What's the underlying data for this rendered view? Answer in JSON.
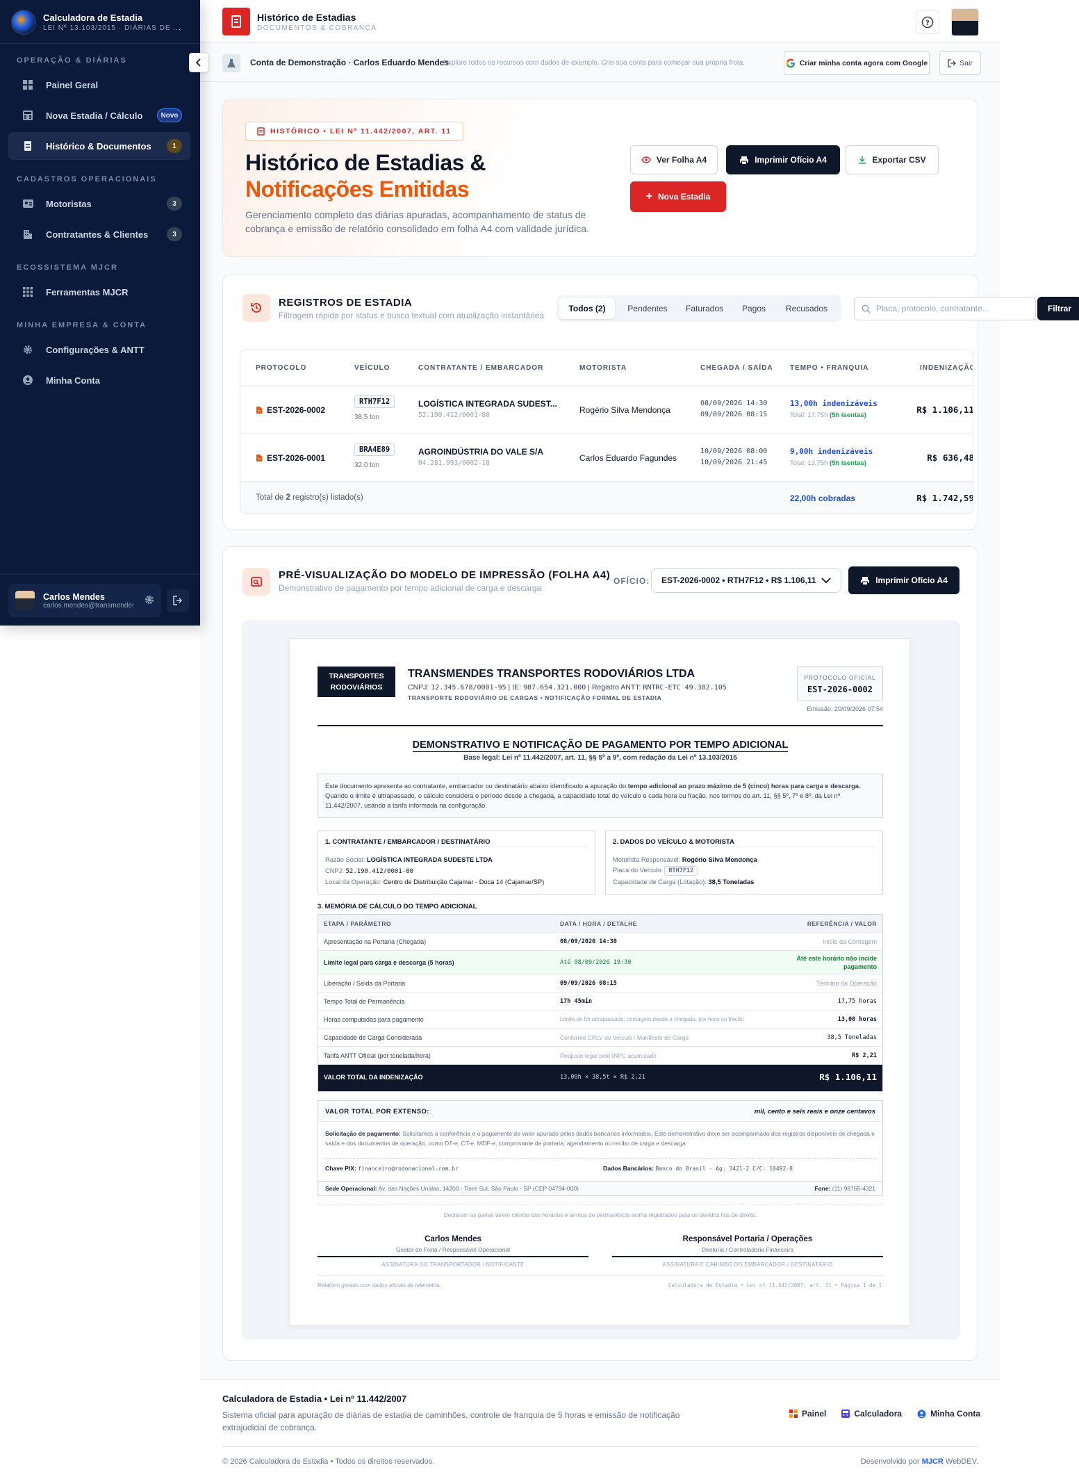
{
  "sidebar": {
    "brand_title": "Calculadora de Estadia",
    "brand_sub": "LEI Nº 13.103/2015 · DIÁRIAS DE ...",
    "sections": {
      "ops": "OPERAÇÃO & DIÁRIAS",
      "cad": "CADASTROS OPERACIONAIS",
      "eco": "ECOSSISTEMA MJCR",
      "emp": "MINHA EMPRESA & CONTA"
    },
    "items": [
      {
        "label": "Painel Geral"
      },
      {
        "label": "Nova Estadia / Cálculo",
        "badge": "Novo"
      },
      {
        "label": "Histórico & Documentos",
        "badge": "1"
      },
      {
        "label": "Motoristas",
        "badge": "3"
      },
      {
        "label": "Contratantes & Clientes",
        "badge": "3"
      },
      {
        "label": "Ferramentas MJCR"
      },
      {
        "label": "Configurações & ANTT"
      },
      {
        "label": "Minha Conta"
      }
    ],
    "user": {
      "name": "Carlos Mendes",
      "email": "carlos.mendes@transmendes"
    }
  },
  "header": {
    "title": "Histórico de Estadias",
    "subtitle": "DOCUMENTOS & COBRANÇA"
  },
  "demo": {
    "title": "Conta de Demonstração · Carlos Eduardo Mendes",
    "desc": "Explore todos os recursos com dados de exemplo. Crie sua conta para começar sua própria frota.",
    "google_btn": "Criar minha conta agora com Google",
    "logout_btn": "Sair"
  },
  "hero": {
    "pill": "HISTÓRICO • LEI Nº 11.442/2007, ART. 11",
    "title_1": "Histórico de Estadias &",
    "title_2": "Notificações Emitidas",
    "desc": "Gerenciamento completo das diárias apuradas, acompanhamento de status de cobrança e emissão de relatório consolidado em folha A4 com validade jurídica.",
    "btn_view": "Ver Folha A4",
    "btn_print": "Imprimir Ofício A4",
    "btn_export": "Exportar CSV",
    "btn_new": "Nova Estadia"
  },
  "registros": {
    "title": "REGISTROS DE ESTADIA",
    "subtitle": "Filtragem rápida por status e busca textual com atualização instantânea",
    "tabs": [
      "Todos (2)",
      "Pendentes",
      "Faturados",
      "Pagos",
      "Recusados"
    ],
    "search_placeholder": "Placa, protocolo, contratante...",
    "filter_btn": "Filtrar",
    "columns": [
      "PROTOCOLO",
      "VEÍCULO",
      "CONTRATANTE / EMBARCADOR",
      "MOTORISTA",
      "CHEGADA / SAÍDA",
      "TEMPO • FRANQUIA",
      "INDENIZAÇÃO"
    ],
    "rows": [
      {
        "protocol": "EST-2026-0002",
        "plate": "RTH7F12",
        "weight": "38,5 ton",
        "company": "LOGÍSTICA INTEGRADA SUDEST...",
        "cnpj": "52.190.412/0001-80",
        "driver": "Rogério Silva Mendonça",
        "arrival": "08/09/2026 14:30",
        "departure": "09/09/2026 08:15",
        "hours": "13,00h indenizáveis",
        "total": "Total: 17,75h",
        "exempt": "(5h isentas)",
        "value": "R$ 1.106,11"
      },
      {
        "protocol": "EST-2026-0001",
        "plate": "BRA4E89",
        "weight": "32,0 ton",
        "company": "AGROINDÚSTRIA DO VALE S/A",
        "cnpj": "04.281.993/0002-18",
        "driver": "Carlos Eduardo Fagundes",
        "arrival": "10/09/2026 08:00",
        "departure": "10/09/2026 21:45",
        "hours": "9,00h indenizáveis",
        "total": "Total: 13,75h",
        "exempt": "(5h isentas)",
        "value": "R$ 636,48"
      }
    ],
    "footer_pre": "Total de ",
    "footer_count": "2",
    "footer_post": " registro(s) listado(s)",
    "footer_hours": "22,00h cobradas",
    "footer_value": "R$ 1.742,59"
  },
  "preview": {
    "title": "PRÉ-VISUALIZAÇÃO DO MODELO DE IMPRESSÃO (FOLHA A4)",
    "subtitle": "Demonstrativo de pagamento por tempo adicional de carga e descarga",
    "oficio_label": "OFÍCIO:",
    "oficio_value": "EST-2026-0002 • RTH7F12 • R$ 1.106,11",
    "print_btn": "Imprimir Ofício A4"
  },
  "doc": {
    "logo_text": "TRANSPORTES RODOVIÁRIOS",
    "company": "TRANSMENDES TRANSPORTES RODOVIÁRIOS LTDA",
    "ids_pre": "CNPJ: ",
    "cnpj": "12.345.678/0001-95",
    "ie_pre": " | IE: ",
    "ie": "987.654.321.000",
    "antt_pre": " | Registro ANTT: ",
    "antt": "RNTRC-ETC 49.382.105",
    "tagline": "TRANSPORTE RODOVIÁRIO DE CARGAS • NOTIFICAÇÃO FORMAL DE ESTADIA",
    "protocol_label": "PROTOCOLO OFICIAL",
    "protocol": "EST-2026-0002",
    "emission": "Emissão: 20/09/2026 07:54",
    "title": "DEMONSTRATIVO E NOTIFICAÇÃO DE PAGAMENTO POR TEMPO ADICIONAL",
    "legal": "Base legal: Lei nº 11.442/2007, art. 11, §§ 5º a 9º, com redação da Lei nº 13.103/2015",
    "intro_1": "Este documento apresenta ao contratante, embarcador ou destinatário abaixo identificado a apuração do ",
    "intro_b": "tempo adicional ao prazo máximo de 5 (cinco) horas para carga e descarga.",
    "intro_2": "Quando o limite é ultrapassado, o cálculo considera o período desde a chegada, a capacidade total do veículo e cada hora ou fração, nos termos do art. 11, §§ 5º, 7º e 8º, da Lei nº 11.442/2007, usando a tarifa informada na configuração.",
    "s1_title": "1. CONTRATANTE / EMBARCADOR / DESTINATÁRIO",
    "s1_l1": "Razão Social: ",
    "s1_v1": "LOGÍSTICA INTEGRADA SUDESTE LTDA",
    "s1_l2": "CNPJ: ",
    "s1_v2": "52.190.412/0001-80",
    "s1_l3": "Local da Operação: ",
    "s1_v3": "Centro de Distribuição Cajamar - Doca 14 (Cajamar/SP)",
    "s2_title": "2. DADOS DO VEÍCULO & MOTORISTA",
    "s2_l1": "Motorista Responsável: ",
    "s2_v1": "Rogério Silva Mendonça",
    "s2_l2": "Placa do Veículo: ",
    "s2_v2": "RTH7F12",
    "s2_l3": "Capacidade de Carga (Lotação): ",
    "s2_v3": "38,5 Toneladas",
    "s3_title": "3. MEMÓRIA DE CÁLCULO DO TEMPO ADICIONAL",
    "calc_cols": [
      "ETAPA / PARÂMETRO",
      "DATA / HORA / DETALHE",
      "REFERÊNCIA / VALOR"
    ],
    "calc_rows": [
      [
        "Apresentação na Portaria (Chegada)",
        "08/09/2026 14:30",
        "Início da Contagem"
      ],
      [
        "Limite legal para carga e descarga (5 horas)",
        "Até 08/09/2026 19:30",
        "Até este horário não incide pagamento"
      ],
      [
        "Liberação / Saída da Portaria",
        "09/09/2026 08:15",
        "Término da Operação"
      ],
      [
        "Tempo Total de Permanência",
        "17h 45min",
        "17,75 horas"
      ],
      [
        "Horas computadas para pagamento",
        "Limite de 5h ultrapassado; contagem desde a chegada, por hora ou fração",
        "13,00 horas"
      ],
      [
        "Capacidade de Carga Considerada",
        "Conforme CRLV do Veículo / Manifesto de Carga",
        "38,5 Toneladas"
      ],
      [
        "Tarifa ANTT Oficial (por tonelada/hora)",
        "Reajuste legal pelo INPC acumulado",
        "R$ 2,21"
      ]
    ],
    "calc_total": [
      "VALOR TOTAL DA INDENIZAÇÃO",
      "13,00h × 38,5t × R$ 2,21",
      "R$ 1.106,11"
    ],
    "extenso_label": "VALOR TOTAL POR EXTENSO:",
    "extenso_value": "mil, cento e seis reais e onze centavos",
    "sol_label": "Solicitação de pagamento:",
    "sol_text": " Solicitamos a conferência e o pagamento do valor apurado pelos dados bancários informados. Este demonstrativo deve ser acompanhado dos registros disponíveis de chegada e saída e dos documentos de operação, como DT-e, CT-e, MDF-e, comprovante de portaria, agendamento ou recibo de carga e descarga.",
    "pix_label": "Chave PIX: ",
    "pix": "financeiro@rodonacional.com.br",
    "bank_label": "Dados Bancários: ",
    "bank": "Banco do Brasil - Ag: 3421-2 C/C: 10492-8",
    "sede_label": "Sede Operacional:",
    "sede": " Av. das Nações Unidas, 14200 - Torre Sul, São Paulo - SP (CEP 04794-000)",
    "fone_label": "Fone:",
    "fone": " (11) 98765-4321",
    "declare": "Declaram as partes terem ciência dos horários e termos de permanência acima registrados para os devidos fins de direito.",
    "sig1_name": "Carlos Mendes",
    "sig1_role": "Gestor de Frota / Responsável Operacional",
    "sig1_caption": "ASSINATURA DO TRANSPORTADOR / NOTIFICANTE",
    "sig2_name": "Responsável Portaria / Operações",
    "sig2_role": "Diretoria / Controladoria Financeira",
    "sig2_caption": "ASSINATURA E CARIMBO DO EMBARCADOR / DESTINATÁRIO",
    "foot_left": "Relatório gerado com dados oficiais de telemetria.",
    "foot_right": "Calculadora de Estadia • Lei nº 11.442/2007, art. 11 • Página 1 de 1"
  },
  "footer": {
    "title": "Calculadora de Estadia • Lei nº 11.442/2007",
    "desc": "Sistema oficial para apuração de diárias de estadia de caminhões, controle de franquia de 5 horas e emissão de notificação extrajudicial de cobrança.",
    "links": [
      "Painel",
      "Calculadora",
      "Minha Conta"
    ],
    "copyright": "© 2026 Calculadora de Estadia • Todos os direitos reservados.",
    "dev_pre": "Desenvolvido por ",
    "dev_brand": "MJCR",
    "dev_post": " WebDEV."
  }
}
